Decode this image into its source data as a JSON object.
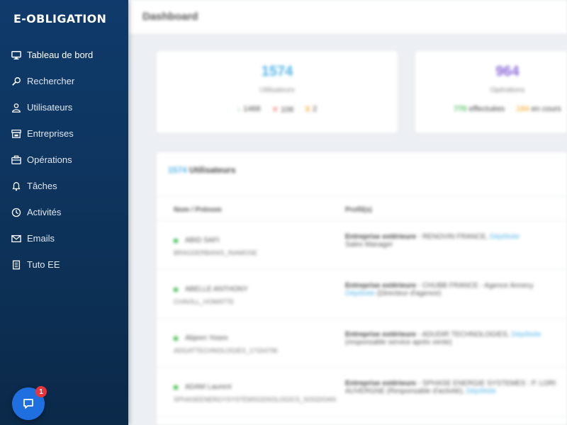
{
  "app": {
    "brand": "E-OBLIGATION"
  },
  "sidebar": {
    "items": [
      {
        "label": "Tableau de bord",
        "icon": "monitor-icon"
      },
      {
        "label": "Rechercher",
        "icon": "search-icon"
      },
      {
        "label": "Utilisateurs",
        "icon": "user-icon"
      },
      {
        "label": "Entreprises",
        "icon": "store-icon"
      },
      {
        "label": "Opérations",
        "icon": "briefcase-icon"
      },
      {
        "label": "Tâches",
        "icon": "bell-icon"
      },
      {
        "label": "Activités",
        "icon": "clock-icon"
      },
      {
        "label": "Emails",
        "icon": "mail-icon"
      },
      {
        "label": "Tuto EE",
        "icon": "document-icon"
      }
    ]
  },
  "chat": {
    "badge": "1"
  },
  "main": {
    "title": "Dashboard",
    "stats": [
      {
        "value": "1574",
        "label": "Utilisateurs",
        "a": "1466",
        "b": "106",
        "c": "2"
      },
      {
        "value": "964",
        "label": "Opérations",
        "a": "770",
        "a_label": "effectuées",
        "b": "194",
        "b_label": "en cours"
      }
    ],
    "users": {
      "count": "1574",
      "title": "Utilisateurs",
      "col_name": "Nom / Prénom",
      "col_profile": "Profil(s)",
      "rows": [
        {
          "name": "ABID SAFI",
          "sub": "BRAGDERBANIS_INAMOSE",
          "prof_bold": "Entreprise extérieure",
          "prof": "RENOVIN FRANCE",
          "link": "Dépôtsite",
          "prof2": "Sales Manager"
        },
        {
          "name": "ABELLE ANTHONY",
          "sub": "CHAVILL_HOMATTE",
          "prof_bold": "Entreprise extérieure",
          "prof": "CHUBB FRANCE - Agence Annecy",
          "link": "Dépôtsite",
          "prof2": "(Directeur d'agence)"
        },
        {
          "name": "Abjeen Yoses",
          "sub": "ADGATTECHNOLOGIES_17154796",
          "prof_bold": "Entreprise extérieure",
          "prof": "ADUDIR TECHNOLOGIES",
          "link": "Dépôtsite",
          "prof2": "(responsable service après vente)"
        },
        {
          "name": "ADAM Laurent",
          "sub": "SPHASEENERGYSYSTEMSGDSOLOGICS_SOGDOAN",
          "prof_bold": "Entreprise extérieure",
          "prof": "SPHASE ENERGIE SYSTEMES : P. LORI",
          "link": "Dépôtsite",
          "prof2": "AUVERGNE (Responsable d'activité)"
        }
      ]
    }
  }
}
